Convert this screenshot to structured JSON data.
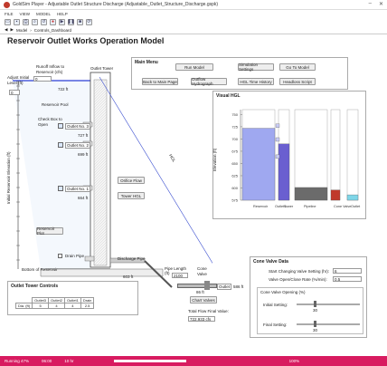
{
  "window": {
    "title": "GoldSim Player - Adjustable Outlet Structure Discharge (Adjustable_Outlet_Structure_Discharge.gspk)",
    "minimize": "–",
    "close": "✕"
  },
  "menu": [
    "FILE",
    "VIEW",
    "MODEL",
    "HELP"
  ],
  "breadcrumb": [
    "Model",
    "Controls_Dashboard"
  ],
  "page_title": "Reservoir Outlet Works Operation Model",
  "left": {
    "runoff_label": "Runoff Inflow to Reservoir (cfs)",
    "runoff_value": "0",
    "adjust_label": "Adjust Initial Level (ft)",
    "adjust_value": "0",
    "level_value": "722 ft",
    "outlet_tower": "Outlet Tower",
    "reservoir_pool": "Reservoir Pool",
    "check_box_label": "Check Box to Open",
    "outlets": [
      {
        "label": "Outlet No. 3",
        "elev": "727 ft"
      },
      {
        "label": "Outlet No. 2",
        "elev": "699 ft"
      },
      {
        "label": "Outlet No. 1",
        "elev": "664 ft"
      }
    ],
    "y_axis_label": "Initial Reservoir Elevation (ft)",
    "reservoir_plot_btn": "Reservoir Plot",
    "drain_pipe": "Drain Pipe",
    "discharge_pipe": "Discharge Pipe",
    "bottom_label": "Bottom of Reservoir",
    "bottom_elev": "603 ft",
    "orifice_flow_btn": "Orifice Flow",
    "tower_hgl_btn": "Tower HGL",
    "hgl_text": "HGL",
    "pipe_length_label": "Pipe Length (ft)",
    "pipe_length_value": "2100",
    "cone_valve_label": "Cone Valve",
    "outlet_label": "Outlet",
    "outlet_elev": "586 ft",
    "valve_elev": "86 ft",
    "chart_valves_btn": "Chart Valves",
    "total_flow_label": "Total Flow Final Value:",
    "total_flow_value": "722.933 cfs"
  },
  "main_menu": {
    "title": "Main Menu",
    "buttons": [
      "Run Model",
      "Simulation Settings",
      "Go To Model",
      "Back to Main Page",
      "Outflow Hydrograph",
      "HGL Time History",
      "Headloss Script"
    ]
  },
  "hgl_chart": {
    "title": "Visual HGL",
    "ylabel": "Elevation (ft)",
    "ticks": [
      "750",
      "725",
      "700",
      "675",
      "650",
      "625",
      "600",
      "575"
    ],
    "categories": [
      "Reservoir",
      "Outlets",
      "Tower",
      "Pipeline",
      "Cone Valve",
      "Outlet"
    ],
    "colors": {
      "reservoir": "#9fa8f0",
      "tower": "#6a5fd0",
      "pipeline": "#6b6b6b",
      "valve": "#c0392b",
      "outlet": "#7fd6e8"
    }
  },
  "chart_data": {
    "type": "bar",
    "title": "Visual HGL",
    "ylabel": "Elevation (ft)",
    "ylim": [
      575,
      760
    ],
    "categories": [
      "Reservoir",
      "Tower",
      "Pipeline",
      "Cone Valve",
      "Outlet"
    ],
    "values": [
      722,
      690,
      601,
      596,
      586
    ]
  },
  "tower_controls": {
    "title": "Outlet Tower Controls",
    "headers": [
      "Outlet3",
      "Outlet2",
      "Outlet1",
      "Drain"
    ],
    "row_label": "Dia. (ft)",
    "values": [
      "5",
      "4",
      "4",
      "2.5"
    ]
  },
  "cone_valve": {
    "title": "Cone Valve Data",
    "start_label": "Start Changing Valve Setting (hr):",
    "start_value": "6",
    "rate_label": "Valve Open/Close Rate (%/min):",
    "rate_value": "0.5",
    "opening_title": "Cone Valve Opening (%)",
    "initial_label": "Initial Setting:",
    "initial_value": "30",
    "final_label": "Final Setting:",
    "final_value": "30"
  },
  "statusbar": {
    "state": "Running 47%",
    "time1": "06:00",
    "time2": "10 hr",
    "zoom": "100%"
  }
}
